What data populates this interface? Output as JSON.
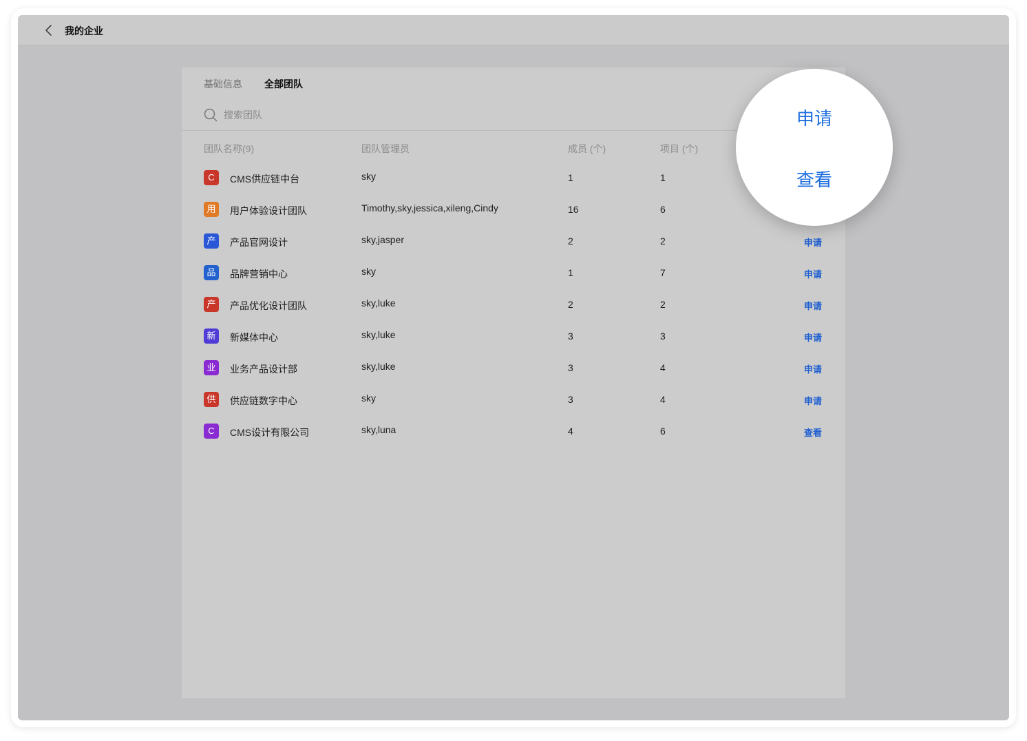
{
  "topbar": {
    "title": "我的企业"
  },
  "tabs": [
    {
      "label": "基础信息",
      "active": false
    },
    {
      "label": "全部团队",
      "active": true
    }
  ],
  "search": {
    "placeholder": "搜索团队",
    "value": ""
  },
  "table": {
    "headers": {
      "name": "团队名称(9)",
      "admins": "团队管理员",
      "members": "成员 (个)",
      "projects": "项目 (个)"
    },
    "rows": [
      {
        "badge": "C",
        "badge_color": "#c9362a",
        "name": "CMS供应链中台",
        "admins": "sky",
        "members": "1",
        "projects": "1",
        "action": ""
      },
      {
        "badge": "用",
        "badge_color": "#e07a27",
        "name": "用户体验设计团队",
        "admins": "Timothy,sky,jessica,xileng,Cindy",
        "members": "16",
        "projects": "6",
        "action": ""
      },
      {
        "badge": "产",
        "badge_color": "#2957d6",
        "name": "产品官网设计",
        "admins": "sky,jasper",
        "members": "2",
        "projects": "2",
        "action": "申请"
      },
      {
        "badge": "品",
        "badge_color": "#2361cf",
        "name": "品牌营销中心",
        "admins": "sky",
        "members": "1",
        "projects": "7",
        "action": "申请"
      },
      {
        "badge": "产",
        "badge_color": "#c9362a",
        "name": "产品优化设计团队",
        "admins": "sky,luke",
        "members": "2",
        "projects": "2",
        "action": "申请"
      },
      {
        "badge": "新",
        "badge_color": "#4f3cd6",
        "name": "新媒体中心",
        "admins": "sky,luke",
        "members": "3",
        "projects": "3",
        "action": "申请"
      },
      {
        "badge": "业",
        "badge_color": "#8a2ad2",
        "name": "业务产品设计部",
        "admins": "sky,luke",
        "members": "3",
        "projects": "4",
        "action": "申请"
      },
      {
        "badge": "供",
        "badge_color": "#c9362a",
        "name": "供应链数字中心",
        "admins": "sky",
        "members": "3",
        "projects": "4",
        "action": "申请"
      },
      {
        "badge": "C",
        "badge_color": "#8a2ad2",
        "name": "CMS设计有限公司",
        "admins": "sky,luna",
        "members": "4",
        "projects": "6",
        "action": "查看"
      }
    ]
  },
  "magnifier": {
    "apply_label": "申请",
    "view_label": "查看"
  },
  "colors": {
    "accent": "#1f6fe0",
    "overlay_bg": "#c1c1c4",
    "panel_bg": "#cccccc"
  }
}
